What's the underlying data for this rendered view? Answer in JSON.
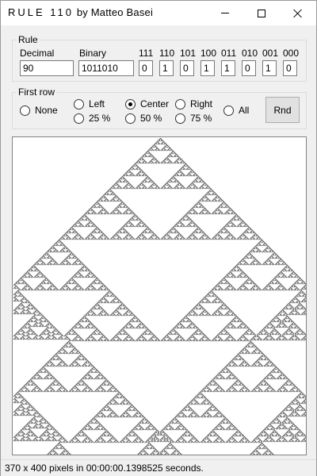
{
  "window": {
    "title_spaced": "RULE 110",
    "title_rest": "by Matteo Basei"
  },
  "rule": {
    "group_label": "Rule",
    "decimal_label": "Decimal",
    "decimal_value": "90",
    "binary_label": "Binary",
    "binary_value": "1011010",
    "bits": [
      {
        "pattern": "111",
        "value": "0"
      },
      {
        "pattern": "110",
        "value": "1"
      },
      {
        "pattern": "101",
        "value": "0"
      },
      {
        "pattern": "100",
        "value": "1"
      },
      {
        "pattern": "011",
        "value": "1"
      },
      {
        "pattern": "010",
        "value": "0"
      },
      {
        "pattern": "001",
        "value": "1"
      },
      {
        "pattern": "000",
        "value": "0"
      }
    ]
  },
  "first_row": {
    "group_label": "First row",
    "options": {
      "none": "None",
      "left": "Left",
      "center": "Center",
      "right": "Right",
      "all": "All",
      "p25": "25 %",
      "p50": "50 %",
      "p75": "75 %"
    },
    "selected": "Center",
    "rnd_label": "Rnd"
  },
  "canvas": {
    "rule_number": 90,
    "cell_columns": 370,
    "cell_rows": 400,
    "fg_color": "#000000",
    "bg_color": "#ffffff"
  },
  "status": {
    "text": "370 x 400 pixels in 00:00:00.1398525 seconds."
  }
}
